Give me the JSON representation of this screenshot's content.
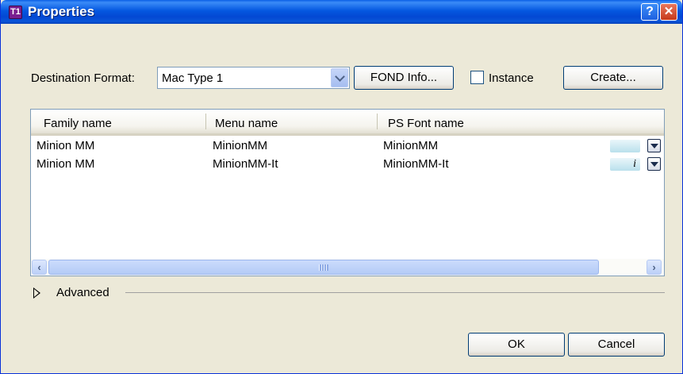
{
  "window": {
    "title": "Properties",
    "app_icon_text": "T1"
  },
  "toolbar": {
    "destination_label": "Destination Format:",
    "destination_value": "Mac Type 1",
    "fond_info_label": "FOND Info...",
    "instance_label": "Instance",
    "instance_checked": false,
    "create_label": "Create..."
  },
  "table": {
    "columns": [
      "Family name",
      "Menu name",
      "PS Font name"
    ],
    "rows": [
      {
        "family": "Minion MM",
        "menu": "MinionMM",
        "ps": "MinionMM",
        "badge": ""
      },
      {
        "family": "Minion MM",
        "menu": "MinionMM-It",
        "ps": "MinionMM-It",
        "badge": "i"
      }
    ]
  },
  "advanced": {
    "label": "Advanced",
    "expanded": false
  },
  "footer": {
    "ok_label": "OK",
    "cancel_label": "Cancel"
  },
  "colors": {
    "titlebar": "#0a55d8",
    "dialog_bg": "#ece9d8",
    "badge_bg": "#b9e0ec"
  }
}
